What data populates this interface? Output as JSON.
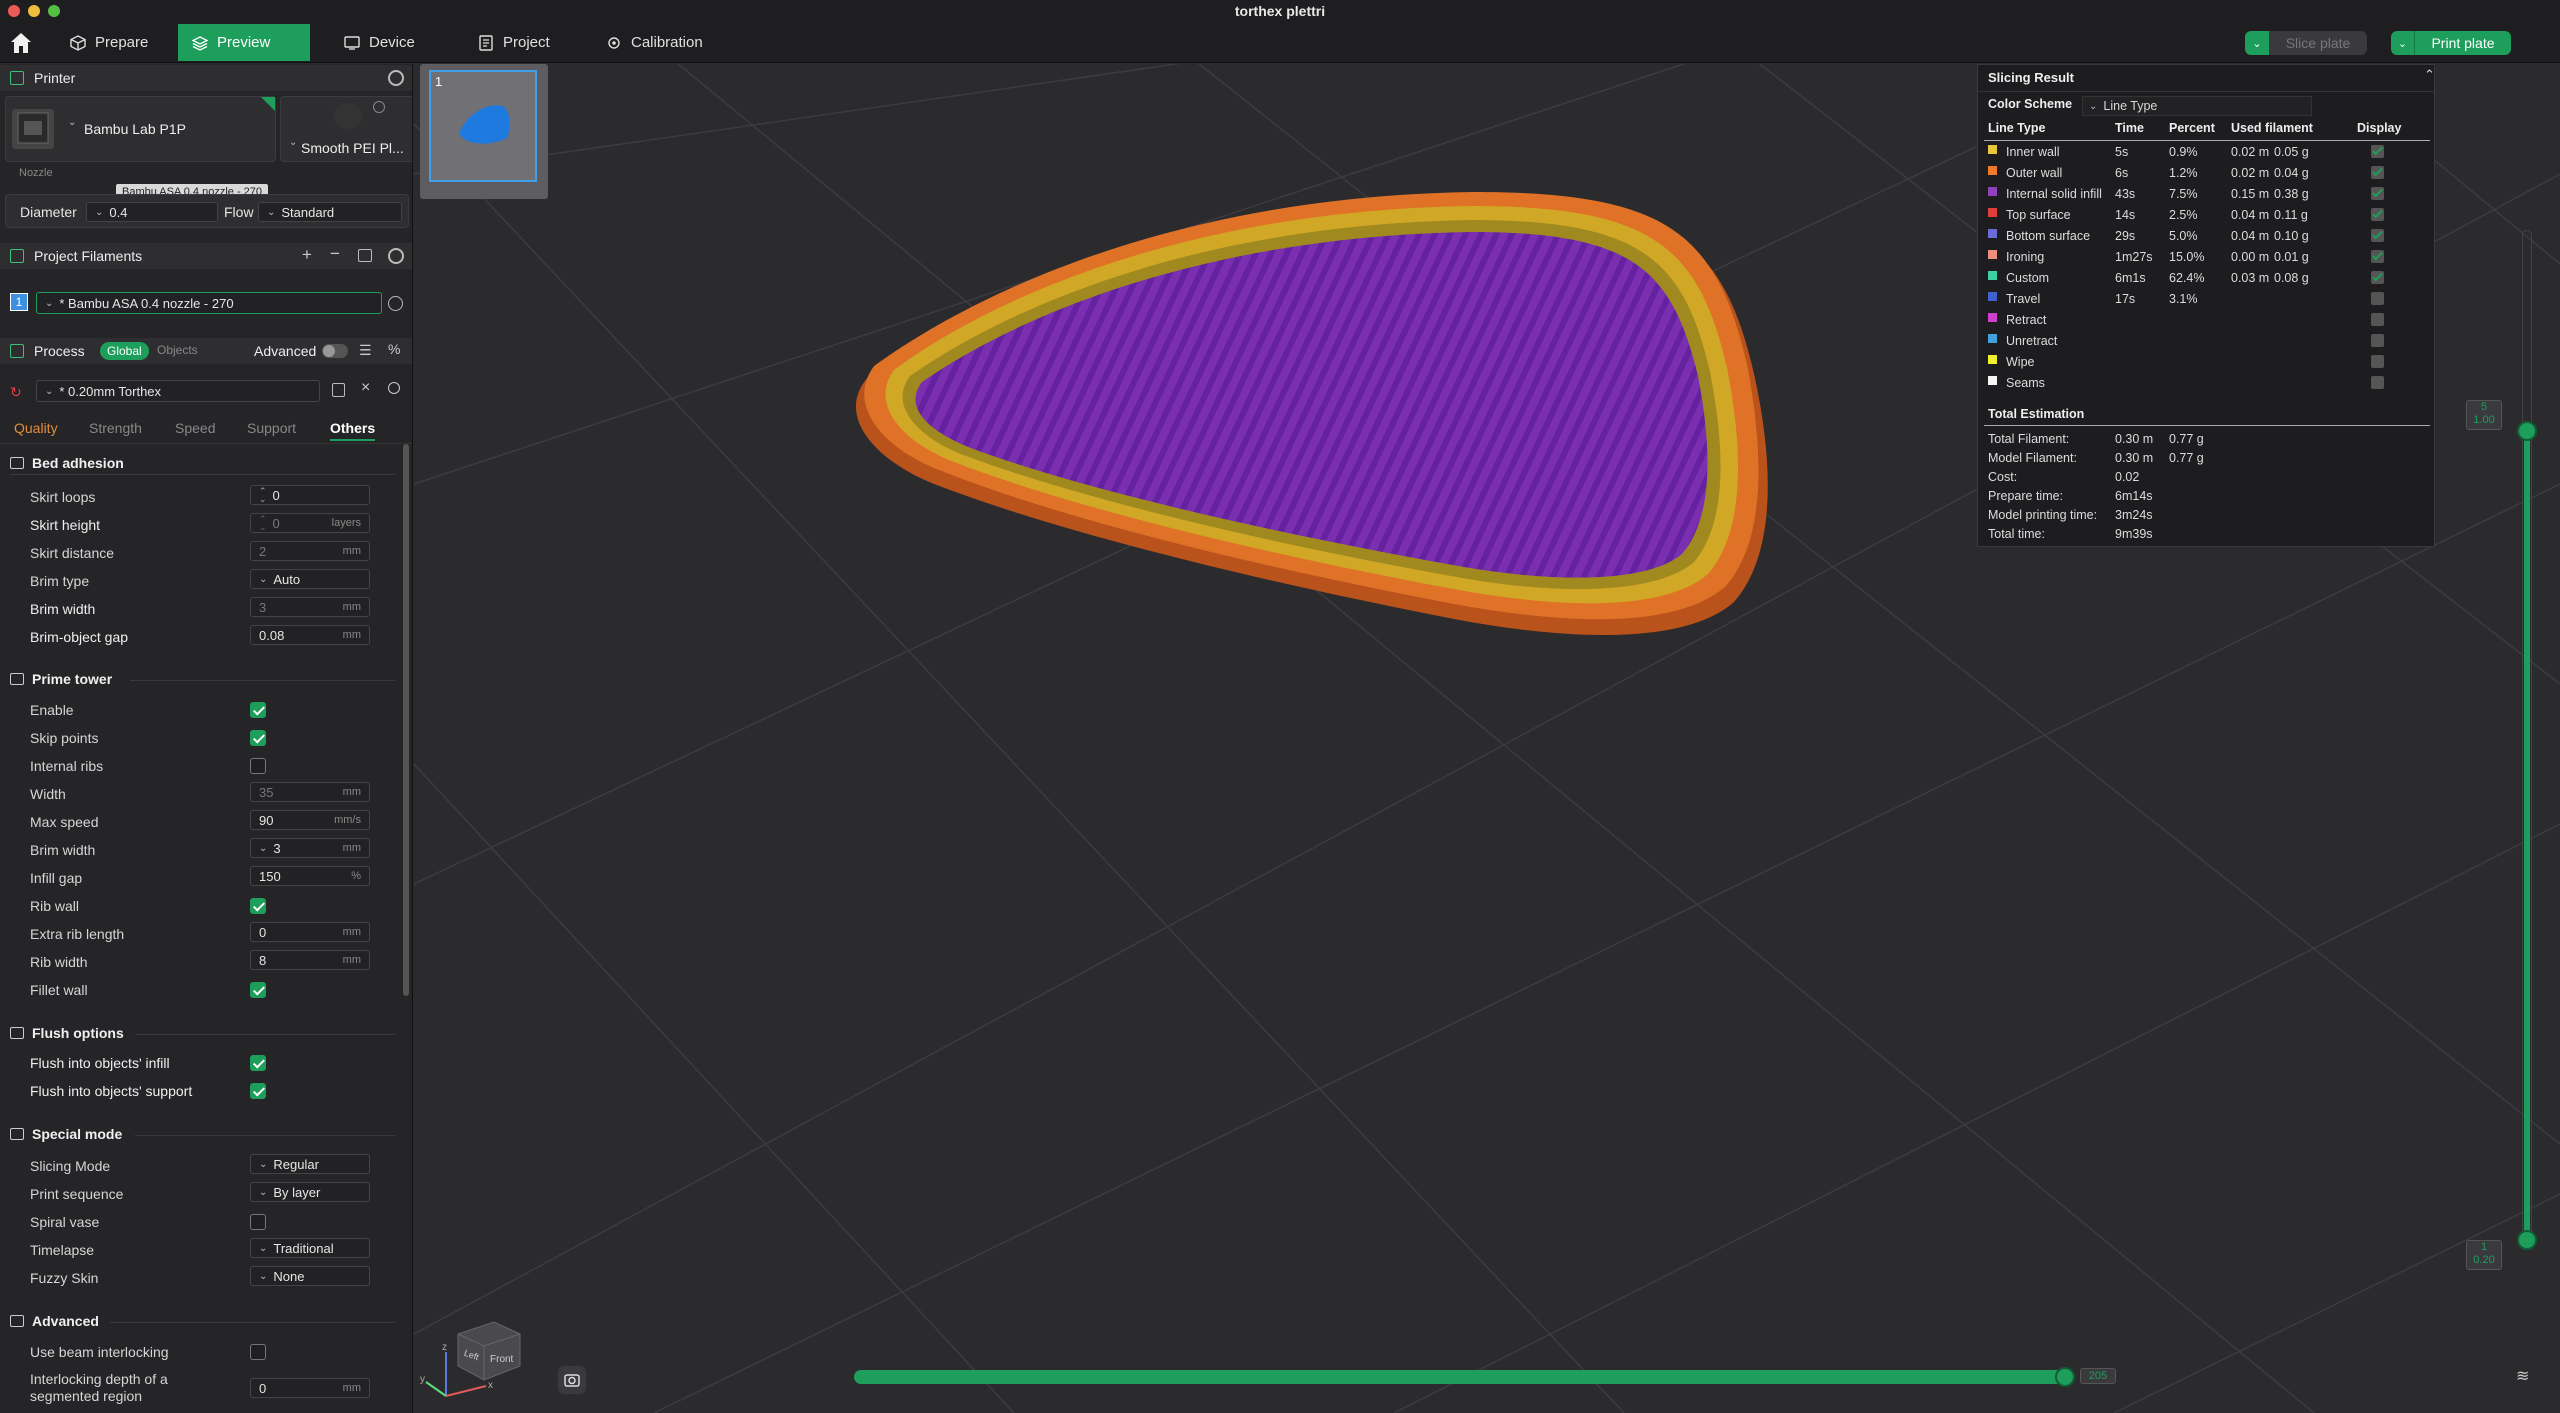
{
  "window": {
    "title": "torthex plettri"
  },
  "nav": {
    "tabs": [
      {
        "label": "Prepare",
        "icon": "cube-icon"
      },
      {
        "label": "Preview",
        "icon": "layers-icon"
      },
      {
        "label": "Device",
        "icon": "device-icon"
      },
      {
        "label": "Project",
        "icon": "project-icon"
      },
      {
        "label": "Calibration",
        "icon": "calibration-icon"
      }
    ],
    "slice_plate": "Slice plate",
    "print_plate": "Print plate",
    "accent": "#1d9e5a"
  },
  "printer": {
    "header": "Printer",
    "name": "Bambu Lab P1P",
    "plate": "Smooth PEI Pl...",
    "nozzle_label": "Nozzle",
    "tooltip": "Bambu ASA 0.4 nozzle - 270",
    "diameter_label": "Diameter",
    "diameter_value": "0.4",
    "flow_label": "Flow",
    "flow_value": "Standard"
  },
  "filaments": {
    "header": "Project Filaments",
    "items": [
      {
        "index": "1",
        "name": "* Bambu ASA 0.4 nozzle - 270",
        "color": "#3d8fe0"
      }
    ]
  },
  "process": {
    "header": "Process",
    "global": "Global",
    "objects": "Objects",
    "advanced": "Advanced",
    "preset": "* 0.20mm Torthex",
    "tabs": [
      "Quality",
      "Strength",
      "Speed",
      "Support",
      "Others"
    ],
    "active_tab": "Others",
    "bed_adhesion": {
      "title": "Bed adhesion",
      "skirt_loops": {
        "label": "Skirt loops",
        "value": "0"
      },
      "skirt_height": {
        "label": "Skirt height",
        "value": "0",
        "unit": "layers"
      },
      "skirt_distance": {
        "label": "Skirt distance",
        "value": "2",
        "unit": "mm"
      },
      "brim_type": {
        "label": "Brim type",
        "value": "Auto"
      },
      "brim_width": {
        "label": "Brim width",
        "value": "3",
        "unit": "mm"
      },
      "brim_gap": {
        "label": "Brim-object gap",
        "value": "0.08",
        "unit": "mm"
      }
    },
    "prime_tower": {
      "title": "Prime tower",
      "enable": "Enable",
      "skip_points": "Skip points",
      "internal_ribs": "Internal ribs",
      "width": {
        "label": "Width",
        "value": "35",
        "unit": "mm"
      },
      "max_speed": {
        "label": "Max speed",
        "value": "90",
        "unit": "mm/s"
      },
      "brim_width": {
        "label": "Brim width",
        "value": "3",
        "unit": "mm"
      },
      "infill_gap": {
        "label": "Infill gap",
        "value": "150",
        "unit": "%"
      },
      "rib_wall": "Rib wall",
      "extra_rib": {
        "label": "Extra rib length",
        "value": "0",
        "unit": "mm"
      },
      "rib_width": {
        "label": "Rib width",
        "value": "8",
        "unit": "mm"
      },
      "fillet_wall": "Fillet wall"
    },
    "flush": {
      "title": "Flush options",
      "infill": "Flush into objects' infill",
      "support": "Flush into objects' support"
    },
    "special": {
      "title": "Special mode",
      "slicing_mode": {
        "label": "Slicing Mode",
        "value": "Regular"
      },
      "print_sequence": {
        "label": "Print sequence",
        "value": "By layer"
      },
      "spiral_vase": "Spiral vase",
      "timelapse": {
        "label": "Timelapse",
        "value": "Traditional"
      },
      "fuzzy_skin": {
        "label": "Fuzzy Skin",
        "value": "None"
      }
    },
    "advanced_group": {
      "title": "Advanced",
      "beam_interlocking": "Use beam interlocking",
      "interlocking_depth_1": "Interlocking depth of a",
      "interlocking_depth_2": "segmented region",
      "interlocking_depth_value": "0",
      "interlocking_depth_unit": "mm"
    }
  },
  "plate": {
    "number": "1"
  },
  "slicing_result": {
    "title": "Slicing Result",
    "color_scheme_label": "Color Scheme",
    "color_scheme_value": "Line Type",
    "headers": [
      "Line Type",
      "Time",
      "Percent",
      "Used filament",
      "Display"
    ],
    "rows": [
      {
        "name": "Inner wall",
        "time": "5s",
        "percent": "0.9%",
        "len": "0.02 m",
        "weight": "0.05 g",
        "color": "#e8c53a",
        "display": true
      },
      {
        "name": "Outer wall",
        "time": "6s",
        "percent": "1.2%",
        "len": "0.02 m",
        "weight": "0.04 g",
        "color": "#f07a2a",
        "display": true
      },
      {
        "name": "Internal solid infill",
        "time": "43s",
        "percent": "7.5%",
        "len": "0.15 m",
        "weight": "0.38 g",
        "color": "#9140c0",
        "display": true
      },
      {
        "name": "Top surface",
        "time": "14s",
        "percent": "2.5%",
        "len": "0.04 m",
        "weight": "0.11 g",
        "color": "#e0403a",
        "display": true
      },
      {
        "name": "Bottom surface",
        "time": "29s",
        "percent": "5.0%",
        "len": "0.04 m",
        "weight": "0.10 g",
        "color": "#6a6ad8",
        "display": true
      },
      {
        "name": "Ironing",
        "time": "1m27s",
        "percent": "15.0%",
        "len": "0.00 m",
        "weight": "0.01 g",
        "color": "#f0907a",
        "display": true
      },
      {
        "name": "Custom",
        "time": "6m1s",
        "percent": "62.4%",
        "len": "0.03 m",
        "weight": "0.08 g",
        "color": "#3ed0a0",
        "display": true
      },
      {
        "name": "Travel",
        "time": "17s",
        "percent": "3.1%",
        "len": "",
        "weight": "",
        "color": "#4060d0",
        "display": false
      },
      {
        "name": "Retract",
        "time": "",
        "percent": "",
        "len": "",
        "weight": "",
        "color": "#d040d0",
        "display": false
      },
      {
        "name": "Unretract",
        "time": "",
        "percent": "",
        "len": "",
        "weight": "",
        "color": "#40a0e0",
        "display": false
      },
      {
        "name": "Wipe",
        "time": "",
        "percent": "",
        "len": "",
        "weight": "",
        "color": "#f0f030",
        "display": false
      },
      {
        "name": "Seams",
        "time": "",
        "percent": "",
        "len": "",
        "weight": "",
        "color": "#f4f4f4",
        "display": false
      }
    ],
    "total_title": "Total Estimation",
    "totals": [
      {
        "label": "Total Filament:",
        "v1": "0.30 m",
        "v2": "0.77 g"
      },
      {
        "label": "Model Filament:",
        "v1": "0.30 m",
        "v2": "0.77 g"
      },
      {
        "label": "Cost:",
        "v1": "0.02",
        "v2": ""
      },
      {
        "label": "Prepare time:",
        "v1": "6m14s",
        "v2": ""
      },
      {
        "label": "Model printing time:",
        "v1": "3m24s",
        "v2": ""
      },
      {
        "label": "Total time:",
        "v1": "9m39s",
        "v2": ""
      }
    ]
  },
  "layer_slider": {
    "top_layer": "5",
    "top_height": "1.00",
    "bottom_layer": "1",
    "bottom_height": "0.20"
  },
  "move_slider": {
    "value": "205"
  },
  "view_cube": {
    "front": "Front",
    "left": "Left"
  }
}
